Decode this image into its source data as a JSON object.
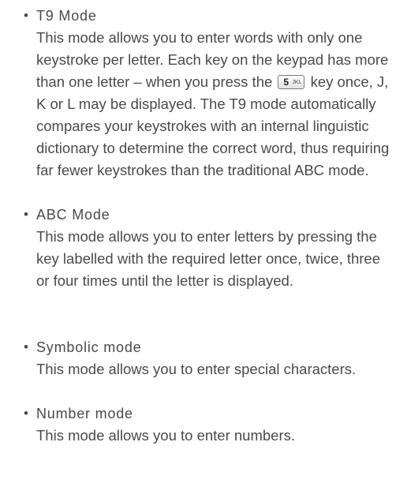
{
  "modes": [
    {
      "bullet": "•",
      "title": "T9 Mode",
      "description_before_key": "This mode allows you to enter words with only one keystroke per letter. Each key on the keypad has more than one letter – when you press the",
      "key_icon": {
        "name": "key-5-icon",
        "digit": "5",
        "sub": "JKL"
      },
      "description_after_key": "key once, J, K or L may be displayed. The T9 mode automatically compares your keystrokes with an internal linguistic dictionary to determine the correct word, thus requiring far fewer keystrokes than the traditional ABC mode."
    },
    {
      "bullet": "•",
      "title": "ABC Mode",
      "description": "This mode allows you to enter letters by pressing the key labelled with the required letter once, twice, three or four times until the letter is displayed."
    },
    {
      "bullet": "•",
      "title": "Symbolic mode",
      "description": "This mode allows you to enter special characters."
    },
    {
      "bullet": "•",
      "title": "Number mode",
      "description": "This mode allows you to enter numbers."
    }
  ],
  "colors": {
    "text": "#4a4a4a",
    "background": "#ffffff"
  }
}
